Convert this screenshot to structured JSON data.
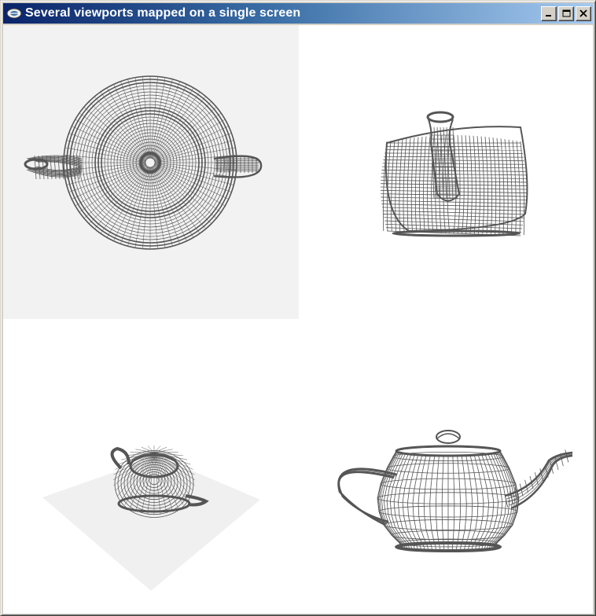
{
  "window": {
    "title": "Several viewports mapped on a single screen"
  },
  "icons": {
    "app": "app-icon",
    "minimize": "minimize-icon",
    "maximize": "maximize-icon",
    "close": "close-icon"
  },
  "colors": {
    "wire": "#555555",
    "viewport_bg": "#f2f2f2",
    "ground": "#f0f0f0",
    "title_start": "#0a246a",
    "title_end": "#a6caf0"
  }
}
